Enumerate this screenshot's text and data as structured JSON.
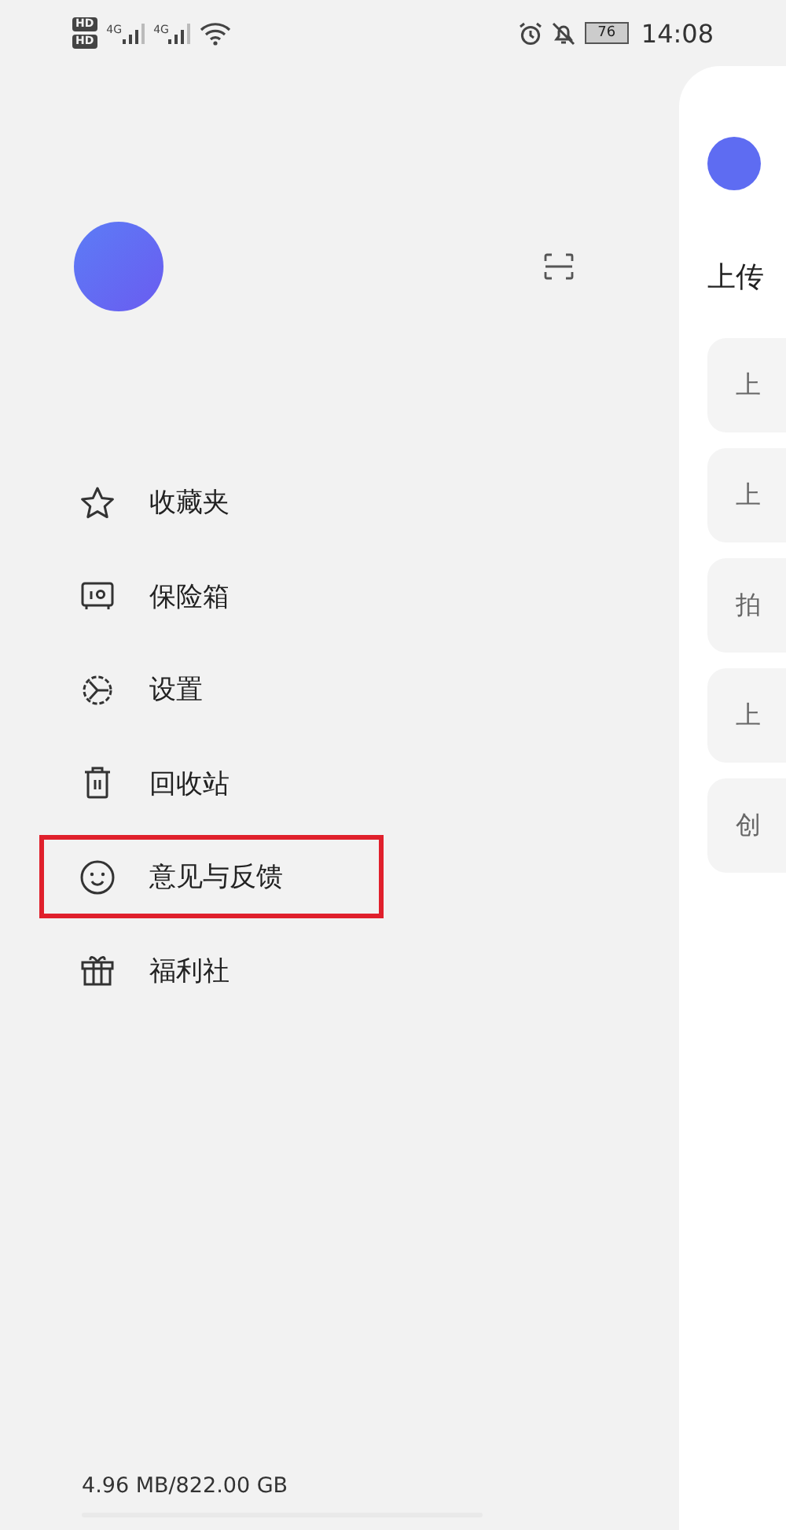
{
  "status_bar": {
    "sim_badges": [
      "HD",
      "HD"
    ],
    "network": [
      "4G",
      "4G"
    ],
    "battery": "76",
    "time": "14:08"
  },
  "drawer": {
    "menu": [
      {
        "kind": "star",
        "label": "收藏夹",
        "highlighted": false
      },
      {
        "kind": "safe",
        "label": "保险箱",
        "highlighted": false
      },
      {
        "kind": "settings",
        "label": "设置",
        "highlighted": false
      },
      {
        "kind": "trash",
        "label": "回收站",
        "highlighted": false
      },
      {
        "kind": "feedback",
        "label": "意见与反馈",
        "highlighted": true
      },
      {
        "kind": "gift",
        "label": "福利社",
        "highlighted": false
      }
    ],
    "storage": {
      "text": "4.96 MB/822.00 GB"
    }
  },
  "panel": {
    "title": "上传",
    "cards": [
      "上",
      "上",
      "拍",
      "上",
      "创"
    ]
  }
}
